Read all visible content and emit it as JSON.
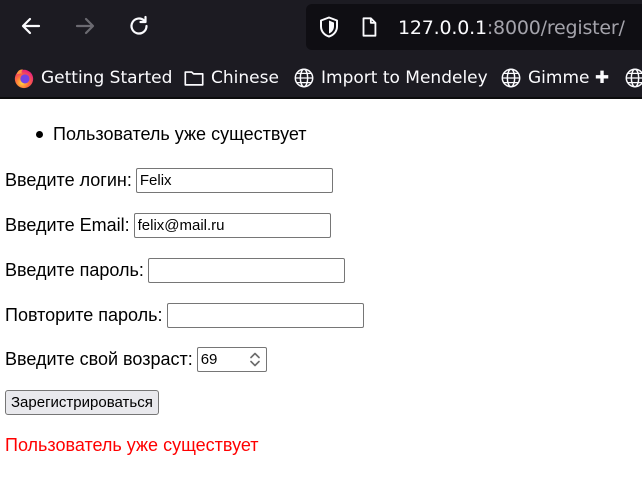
{
  "browser": {
    "url_host": "127.0.0.1",
    "url_path": ":8000/register/",
    "bookmarks": [
      {
        "label": "Getting Started",
        "icon": "firefox-icon"
      },
      {
        "label": "Chinese",
        "icon": "folder-icon"
      },
      {
        "label": "Import to Mendeley",
        "icon": "globe-icon"
      },
      {
        "label": "Gimme ✚",
        "icon": "globe-icon"
      }
    ]
  },
  "form": {
    "errors": [
      "Пользователь уже существует"
    ],
    "login_label": "Введите логин:",
    "login_value": "Felix",
    "email_label": "Введите Email:",
    "email_value": "felix@mail.ru",
    "password_label": "Введите пароль:",
    "password_value": "",
    "password_repeat_label": "Повторите пароль:",
    "password_repeat_value": "",
    "age_label": "Введите свой возраст:",
    "age_value": "69",
    "submit_label": "Зарегистрироваться",
    "error_message": "Пользователь уже существует"
  },
  "colors": {
    "chrome_bg": "#1c1b22",
    "urlbar_bg": "#0f0e13",
    "error_text": "#ff0000"
  }
}
